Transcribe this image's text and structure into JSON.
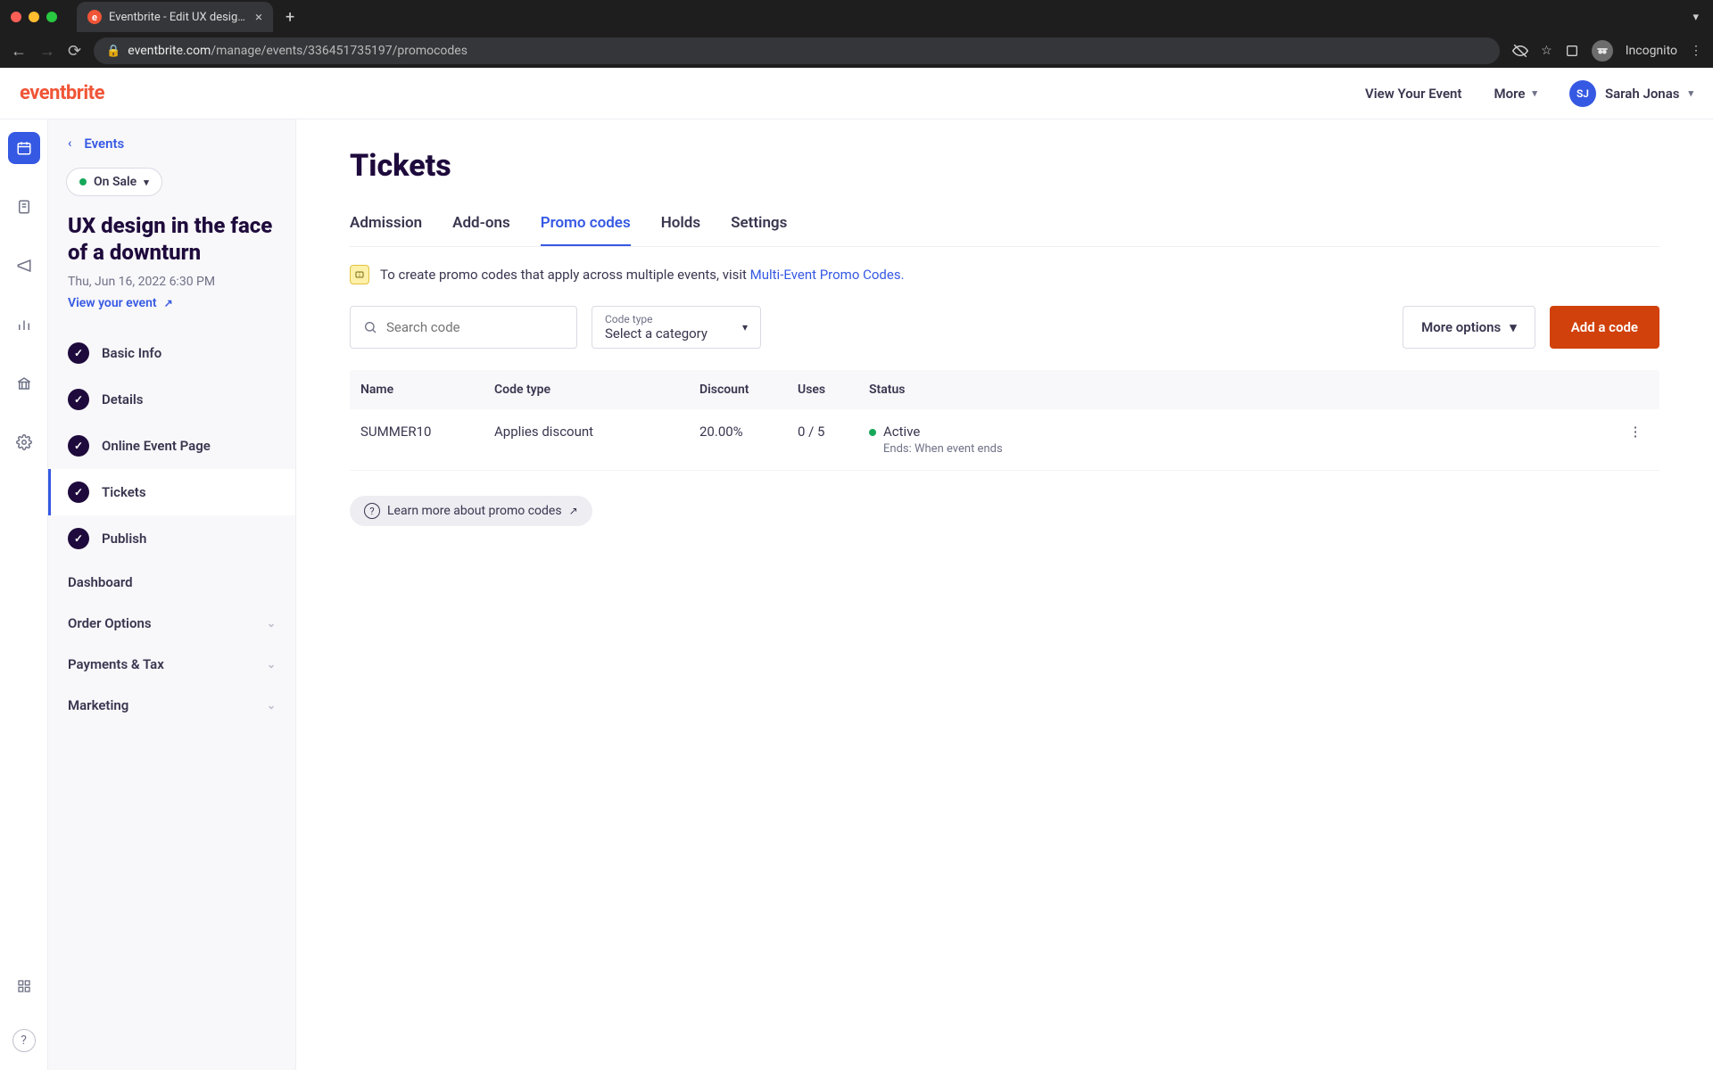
{
  "browser": {
    "tab_title": "Eventbrite - Edit UX design in ...",
    "url_host": "eventbrite.com",
    "url_path": "/manage/events/336451735197/promocodes",
    "incognito_label": "Incognito"
  },
  "header": {
    "logo": "eventbrite",
    "view_event": "View Your Event",
    "more": "More",
    "user_initials": "SJ",
    "user_name": "Sarah Jonas"
  },
  "sidebar": {
    "back_label": "Events",
    "status": "On Sale",
    "event_title": "UX design in the face of a downturn",
    "event_datetime": "Thu, Jun 16, 2022 6:30 PM",
    "view_link": "View your event",
    "nav": {
      "basic_info": "Basic Info",
      "details": "Details",
      "online_event_page": "Online Event Page",
      "tickets": "Tickets",
      "publish": "Publish",
      "dashboard": "Dashboard",
      "order_options": "Order Options",
      "payments_tax": "Payments & Tax",
      "marketing": "Marketing"
    }
  },
  "content": {
    "page_title": "Tickets",
    "tabs": {
      "admission": "Admission",
      "addons": "Add-ons",
      "promo": "Promo codes",
      "holds": "Holds",
      "settings": "Settings"
    },
    "tip_text": "To create promo codes that apply across multiple events, visit ",
    "tip_link": "Multi-Event Promo Codes.",
    "search_placeholder": "Search code",
    "code_type_label": "Code type",
    "code_type_value": "Select a category",
    "more_options": "More options",
    "add_code": "Add a code",
    "columns": {
      "name": "Name",
      "code_type": "Code type",
      "discount": "Discount",
      "uses": "Uses",
      "status": "Status"
    },
    "rows": [
      {
        "name": "SUMMER10",
        "code_type": "Applies discount",
        "discount": "20.00%",
        "uses": "0 / 5",
        "status": "Active",
        "status_sub": "Ends: When event ends"
      }
    ],
    "learn_more": "Learn more about promo codes"
  },
  "colors": {
    "accent_blue": "#3659e3",
    "brand_orange": "#f05537",
    "cta": "#d1410c",
    "green": "#16a85a"
  }
}
